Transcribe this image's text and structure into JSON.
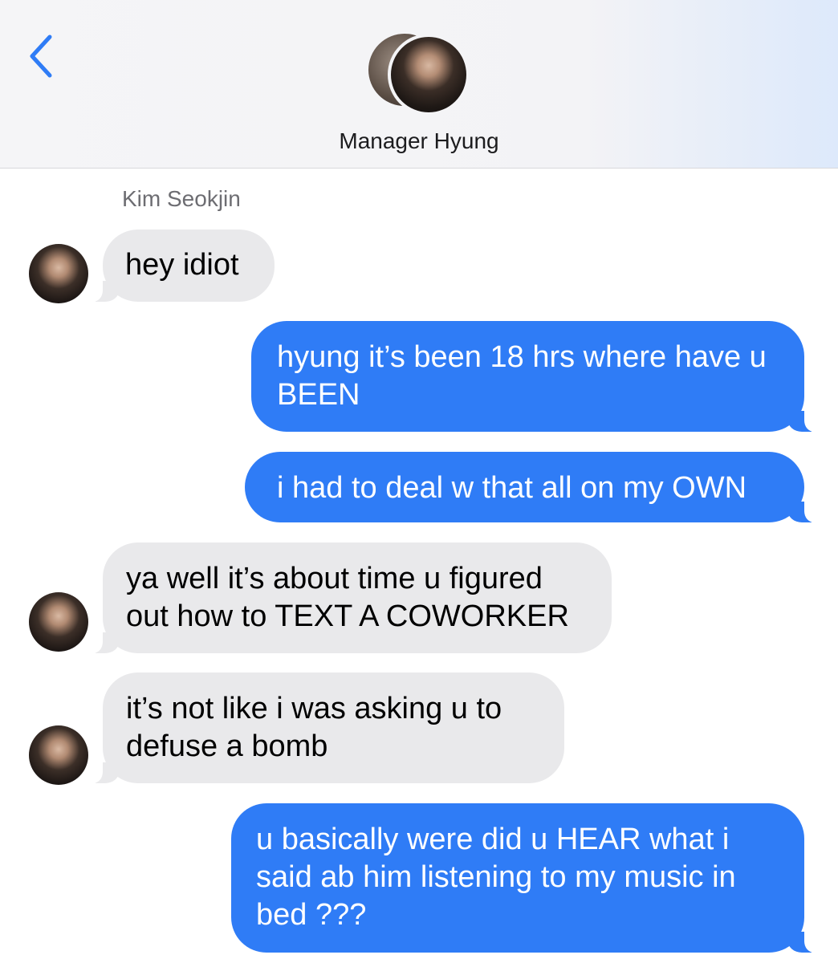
{
  "header": {
    "contact_name": "Manager Hyung",
    "back_icon": "chevron-left-icon",
    "accent_color": "#2f7cf6"
  },
  "thread": {
    "sender_label": "Kim Seokjin",
    "messages": [
      {
        "direction": "incoming",
        "text": "hey idiot"
      },
      {
        "direction": "outgoing",
        "text": "hyung it’s been 18 hrs where have u BEEN"
      },
      {
        "direction": "outgoing",
        "text": "i had to deal w that all on my OWN"
      },
      {
        "direction": "incoming",
        "text": "ya well it’s about time u figured out how to TEXT A COWORKER"
      },
      {
        "direction": "incoming",
        "text": "it’s not like i was asking u to defuse a bomb"
      },
      {
        "direction": "outgoing",
        "text": "u basically were did u HEAR what i said ab him listening to my music in bed ???"
      }
    ]
  },
  "colors": {
    "incoming_bubble": "#e9e9eb",
    "outgoing_bubble": "#2f7cf6"
  }
}
